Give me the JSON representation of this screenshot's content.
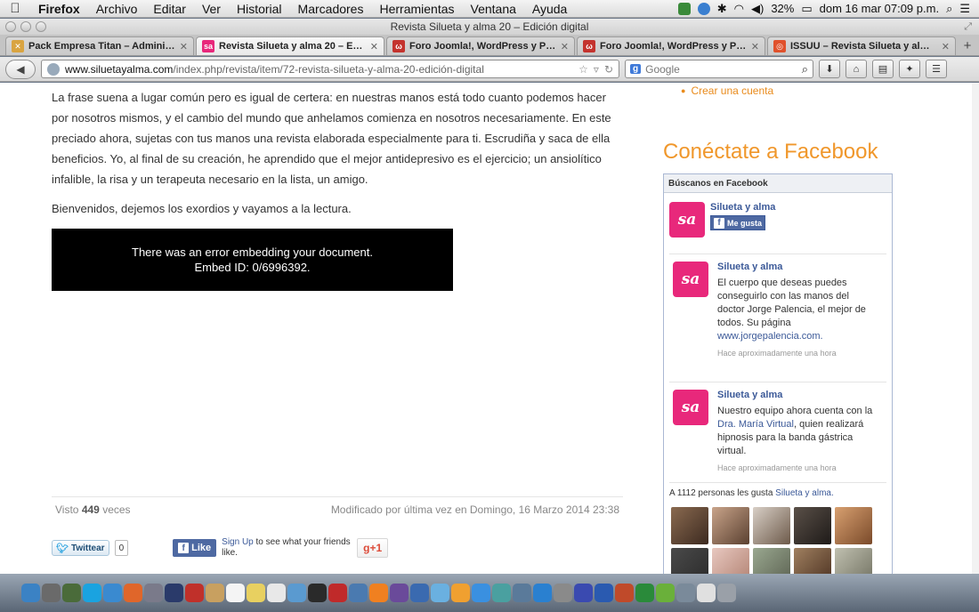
{
  "menubar": {
    "app_name": "Firefox",
    "items": [
      "Archivo",
      "Editar",
      "Ver",
      "Historial",
      "Marcadores",
      "Herramientas",
      "Ventana",
      "Ayuda"
    ],
    "battery": "32%",
    "clock": "dom 16 mar  07:09 p.m."
  },
  "window": {
    "title": "Revista Silueta y alma 20 – Edición digital"
  },
  "tabs": [
    {
      "label": "Pack Empresa Titan – Administ...",
      "favicon_color": "#d9a441",
      "favicon_glyph": "✕"
    },
    {
      "label": "Revista Silueta y alma 20 – Edi...",
      "favicon_color": "#e8287b",
      "favicon_glyph": "sa"
    },
    {
      "label": "Foro Joomla!, WordPress y Pres...",
      "favicon_color": "#c4332e",
      "favicon_glyph": "ω"
    },
    {
      "label": "Foro Joomla!, WordPress y Pres...",
      "favicon_color": "#c4332e",
      "favicon_glyph": "ω"
    },
    {
      "label": "ISSUU – Revista Silueta y alma ...",
      "favicon_color": "#e0512c",
      "favicon_glyph": "◎"
    }
  ],
  "navbar": {
    "url_domain": "www.siluetayalma.com",
    "url_path": "/index.php/revista/item/72-revista-silueta-y-alma-20-edición-digital",
    "search_engine": "g",
    "search_placeholder": "Google"
  },
  "article": {
    "paragraphs": [
      "La frase suena a lugar común pero es igual de certera: en nuestras manos está todo cuanto podemos hacer por nosotros mismos, y el cambio del mundo que anhelamos comienza en nosotros necesariamente. En este preciado ahora, sujetas con tus manos una revista elaborada especialmente para ti. Escrudiña y saca de ella beneficios. Yo, al final de su creación, he aprendido que el mejor antidepresivo es el ejercicio; un ansiolítico infalible, la risa y un terapeuta necesario en la lista, un amigo."
    ],
    "welcome": "Bienvenidos, dejemos los exordios y vayamos a la lectura.",
    "embed_error_line1": "There was an error embedding your document.",
    "embed_error_line2": "Embed ID: 0/6996392.",
    "views_prefix": "Visto",
    "views_count": "449",
    "views_suffix": "veces",
    "modified": "Modificado por última vez en Domingo, 16 Marzo 2014 23:38"
  },
  "social": {
    "tweet_label": "Twittear",
    "tweet_count": "0",
    "like_label": "Like",
    "signup_link": "Sign Up",
    "signup_text": "to see what your friends like.",
    "gplus_label": "g+1"
  },
  "sidebar": {
    "create_account": "Crear una cuenta",
    "facebook_heading": "Conéctate a Facebook",
    "fb_box_title": "Búscanos en Facebook",
    "page_name": "Silueta y alma",
    "like_button": "Me gusta",
    "posts": [
      {
        "author": "Silueta y alma",
        "text": "El cuerpo que deseas puedes conseguirlo con las manos del doctor Jorge Palencia, el mejor de todos. Su página",
        "link": "www.jorgepalencia.com.",
        "time": "Hace aproximadamente una hora"
      },
      {
        "author": "Silueta y alma",
        "text_before": "Nuestro equipo ahora cuenta con la",
        "highlight": "Dra. María Virtual",
        "text_after": ", quien realizará hipnosis para la banda gástrica virtual.",
        "time": "Hace aproximadamente una hora"
      }
    ],
    "likes_prefix": "A 1112 personas les gusta",
    "likes_page": "Silueta y alma."
  },
  "colors": {
    "brand_pink": "#e8287b",
    "facebook_blue": "#3b5998",
    "heading_orange": "#f0972b"
  },
  "dock_icons": [
    "finder-icon",
    "dashboard-icon",
    "mission-control-icon",
    "skype-icon",
    "safari-icon",
    "firefox-icon",
    "utility-icon",
    "photoshop-icon",
    "acrobat-icon",
    "contacts-icon",
    "calendar-icon",
    "notes-icon",
    "textedit-icon",
    "preview-icon",
    "dvd-icon",
    "photo-booth-icon",
    "iphoto-icon",
    "vlc-icon",
    "imovie-icon",
    "quicktime-icon",
    "itunes-icon",
    "ibooks-icon",
    "app-store-icon",
    "time-machine-icon",
    "migration-icon",
    "download-icon",
    "system-prefs-icon",
    "blurb-icon",
    "word-icon",
    "powerpoint-icon",
    "excel-icon",
    "media-icon",
    "network-icon",
    "document-icon",
    "trash-icon"
  ]
}
